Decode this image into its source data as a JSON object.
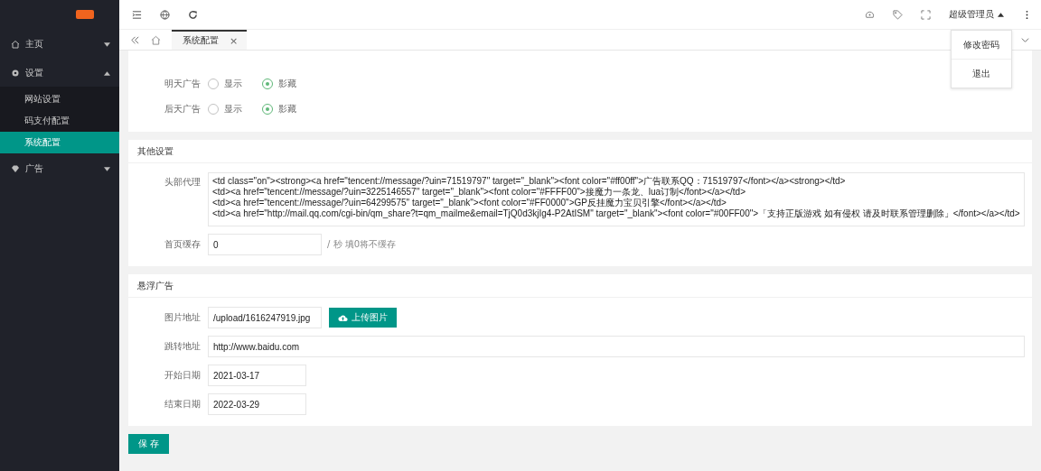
{
  "sidebar": {
    "items": [
      {
        "label": "主页",
        "expanded": false,
        "selected": false
      },
      {
        "label": "设置",
        "expanded": true,
        "selected": false,
        "children": [
          {
            "label": "网站设置",
            "selected": false
          },
          {
            "label": "码支付配置",
            "selected": false
          },
          {
            "label": "系统配置",
            "selected": true
          }
        ]
      },
      {
        "label": "广告",
        "expanded": false,
        "selected": false
      }
    ]
  },
  "header": {
    "user": "超级管理员",
    "menu": [
      {
        "label": "修改密码"
      },
      {
        "label": "退出"
      }
    ]
  },
  "tabs": [
    {
      "label": "系统配置",
      "selected": true,
      "close": "×"
    }
  ],
  "ad_section": {
    "rows": [
      {
        "label": "明天广告",
        "options": [
          {
            "label": "显示",
            "selected": false
          },
          {
            "label": "影藏",
            "selected": true
          }
        ]
      },
      {
        "label": "后天广告",
        "options": [
          {
            "label": "显示",
            "selected": false
          },
          {
            "label": "影藏",
            "selected": true
          }
        ]
      }
    ]
  },
  "other_settings": {
    "title": "其他设置",
    "header_proxy": {
      "label": "头部代理",
      "value": "<td class=\"on\"><strong><a href=\"tencent://message/?uin=71519797\" target=\"_blank\"><font color=\"#ff00ff\">广告联系QQ：71519797</font></a><strong></td>\n<td><a href=\"tencent://message/?uin=3225146557\" target=\"_blank\"><font color=\"#FFFF00\">接魔力一条龙、lua订制</font></a></td>\n<td><a href=\"tencent://message/?uin=64299575\" target=\"_blank\"><font color=\"#FF0000\">GP反挂魔力宝贝引擎</font></a></td>\n<td><a href=\"http://mail.qq.com/cgi-bin/qm_share?t=qm_mailme&email=TjQ0d3kjIg4-P2AtISM\" target=\"_blank\"><font color=\"#00FF00\">「支持正版游戏 如有侵权 请及时联系管理删除」</font></a></td>"
    },
    "cache": {
      "label": "首页缓存",
      "value": "0",
      "hint": "/ 秒 填0将不缓存"
    }
  },
  "float_ad": {
    "title": "悬浮广告",
    "image": {
      "label": "图片地址",
      "value": "/upload/1616247919.jpg",
      "button": "上传图片"
    },
    "link": {
      "label": "跳转地址",
      "value": "http://www.baidu.com"
    },
    "start": {
      "label": "开始日期",
      "value": "2021-03-17"
    },
    "end": {
      "label": "结束日期",
      "value": "2022-03-29"
    }
  },
  "save_button": "保 存"
}
